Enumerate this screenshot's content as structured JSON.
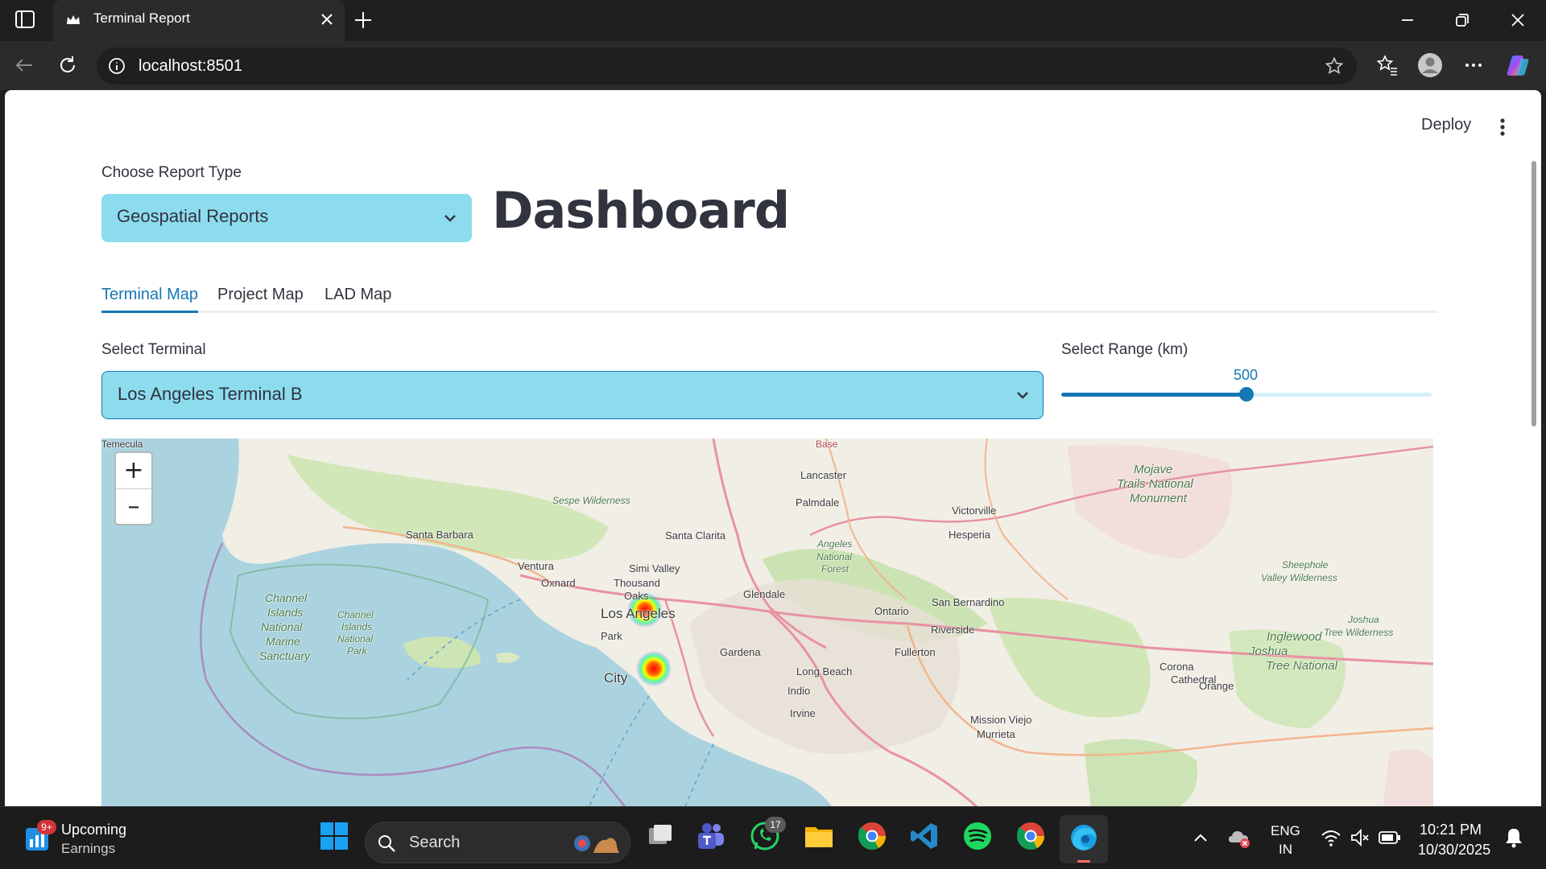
{
  "browser": {
    "tab_title": "Terminal Report",
    "url": "localhost:8501"
  },
  "app": {
    "deploy_label": "Deploy",
    "report_type_label": "Choose Report Type",
    "report_type_value": "Geospatial Reports",
    "dashboard_title": "Dashboard",
    "tabs": [
      {
        "label": "Terminal Map",
        "active": true
      },
      {
        "label": "Project Map",
        "active": false
      },
      {
        "label": "LAD Map",
        "active": false
      }
    ],
    "terminal_label": "Select Terminal",
    "terminal_value": "Los Angeles Terminal B",
    "range_label": "Select Range (km)",
    "range_value": "500",
    "range_fraction": 0.5,
    "accent_color": "#1677b5",
    "select_color": "#8ddcee"
  },
  "map": {
    "zoom_in": "+",
    "zoom_out": "–",
    "places": [
      "Base",
      "Lancaster",
      "Palmdale",
      "Sespe Wilderness",
      "Victorville",
      "Mojave",
      "Trails National",
      "Monument",
      "Santa Barbara",
      "Santa Clarita",
      "Hesperia",
      "Angeles",
      "National",
      "Forest",
      "Ventura",
      "Simi Valley",
      "Oxnard",
      "Thousand",
      "Oaks",
      "Glendale",
      "Sheephole",
      "Valley Wilderness",
      "San Bernardino",
      "Ontario",
      "Channel",
      "Islands",
      "National",
      "Marine",
      "Sanctuary",
      "Channel",
      "Islands",
      "National",
      "Park",
      "Los Angeles",
      "Riverside",
      "Joshua",
      "Tree Wilderness",
      "Inglewood",
      "Joshua",
      "Tree National",
      "Park",
      "Gardena",
      "Fullerton",
      "Corona",
      "Cathedral",
      "City",
      "Long Beach",
      "Orange",
      "Indio",
      "Irvine",
      "Mission Viejo",
      "Murrieta",
      "Temecula"
    ],
    "heat_points": [
      "Los Angeles",
      "Long Beach"
    ]
  },
  "taskbar": {
    "widget_badge": "9+",
    "widget_line1": "Upcoming",
    "widget_line2": "Earnings",
    "search_placeholder": "Search",
    "whatsapp_badge": "17",
    "lang_line1": "ENG",
    "lang_line2": "IN",
    "time": "10:21 PM",
    "date": "10/30/2025"
  }
}
